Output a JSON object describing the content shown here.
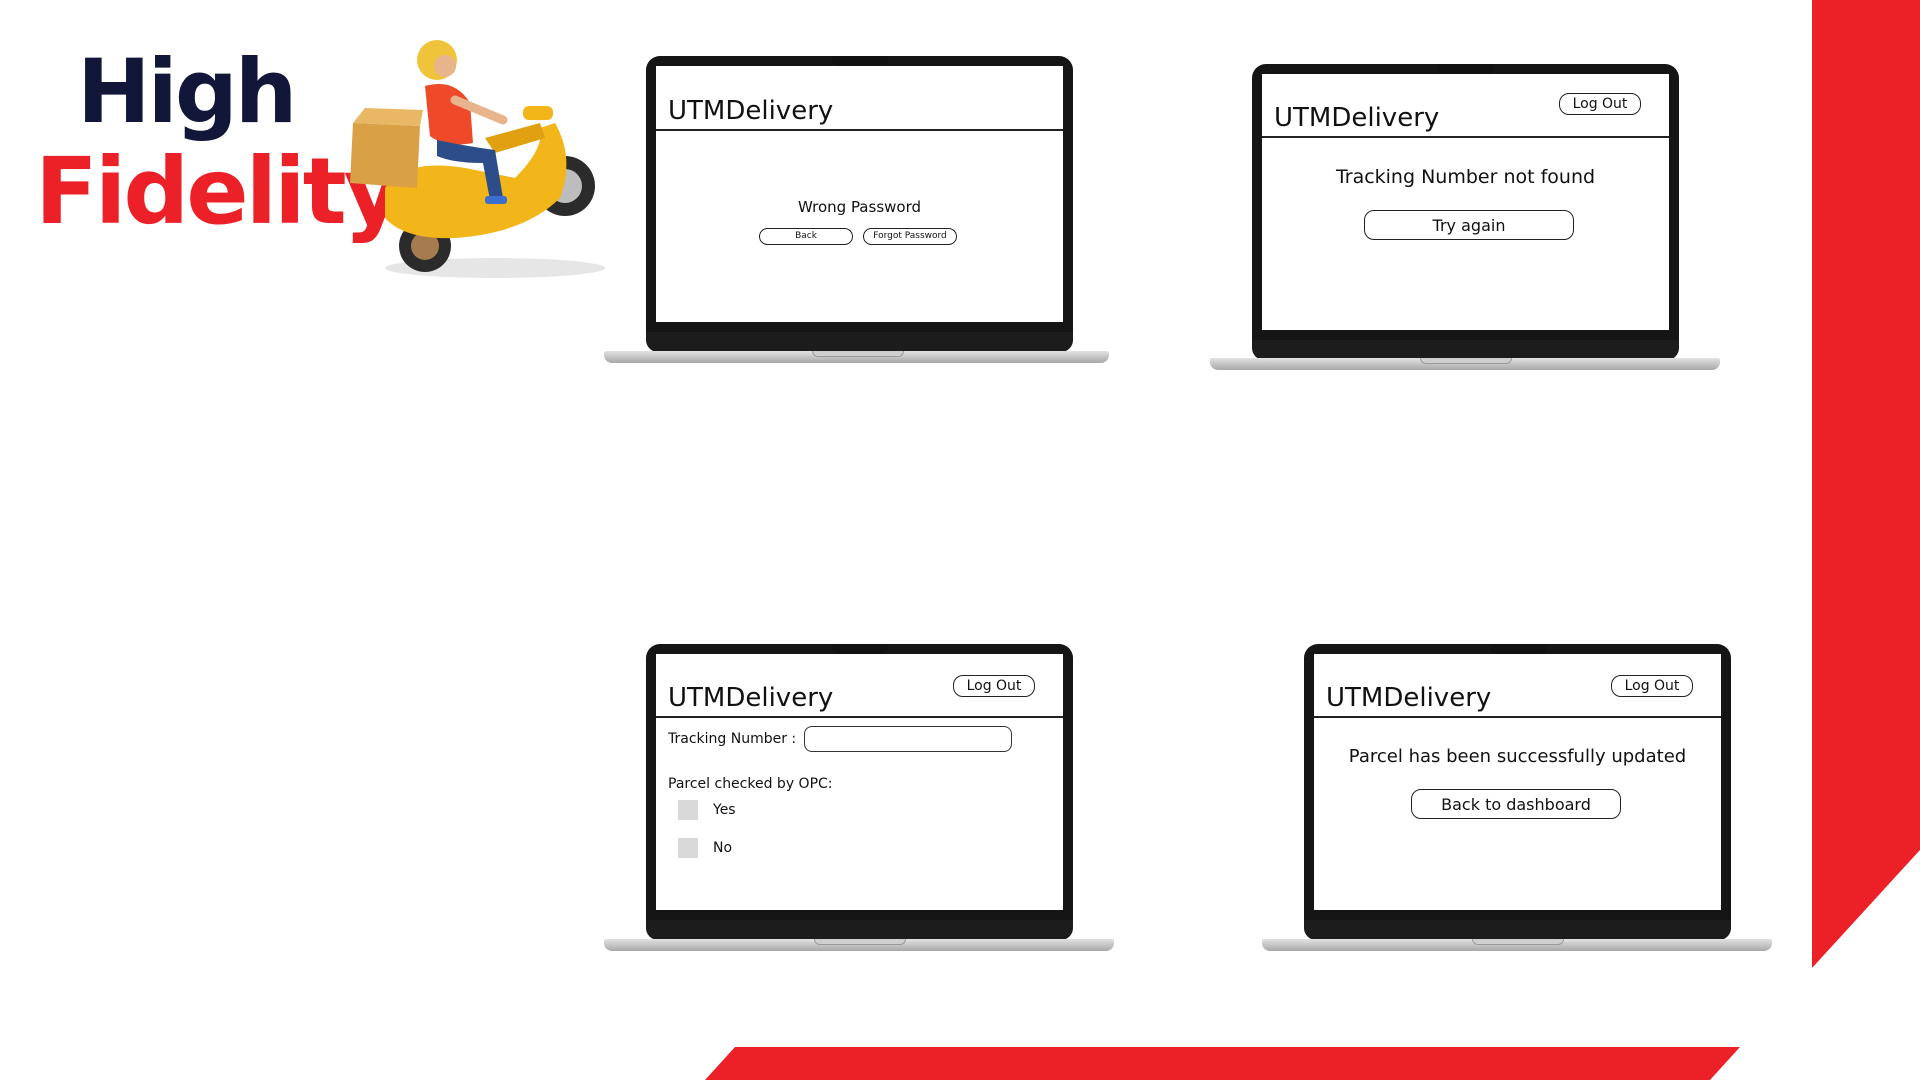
{
  "slide": {
    "title_line1": "High",
    "title_line2": "Fidelity",
    "colors": {
      "accent_red": "#ec2127",
      "navy": "#12173a"
    }
  },
  "screens": {
    "wrong_password": {
      "app_title": "UTMDelivery",
      "message": "Wrong Password",
      "back_label": "Back",
      "forgot_label": "Forgot Password"
    },
    "tracking_not_found": {
      "app_title": "UTMDelivery",
      "logout_label": "Log Out",
      "message": "Tracking Number not found",
      "try_again_label": "Try again"
    },
    "update_parcel": {
      "app_title": "UTMDelivery",
      "logout_label": "Log Out",
      "tracking_label": "Tracking Number :",
      "tracking_value": "",
      "checked_label": "Parcel checked by OPC:",
      "options": [
        "Yes",
        "No"
      ]
    },
    "update_success": {
      "app_title": "UTMDelivery",
      "logout_label": "Log Out",
      "message": "Parcel has been successfully updated",
      "back_dashboard_label": "Back to dashboard"
    }
  },
  "icons": [
    "delivery-scooter-illustration"
  ]
}
